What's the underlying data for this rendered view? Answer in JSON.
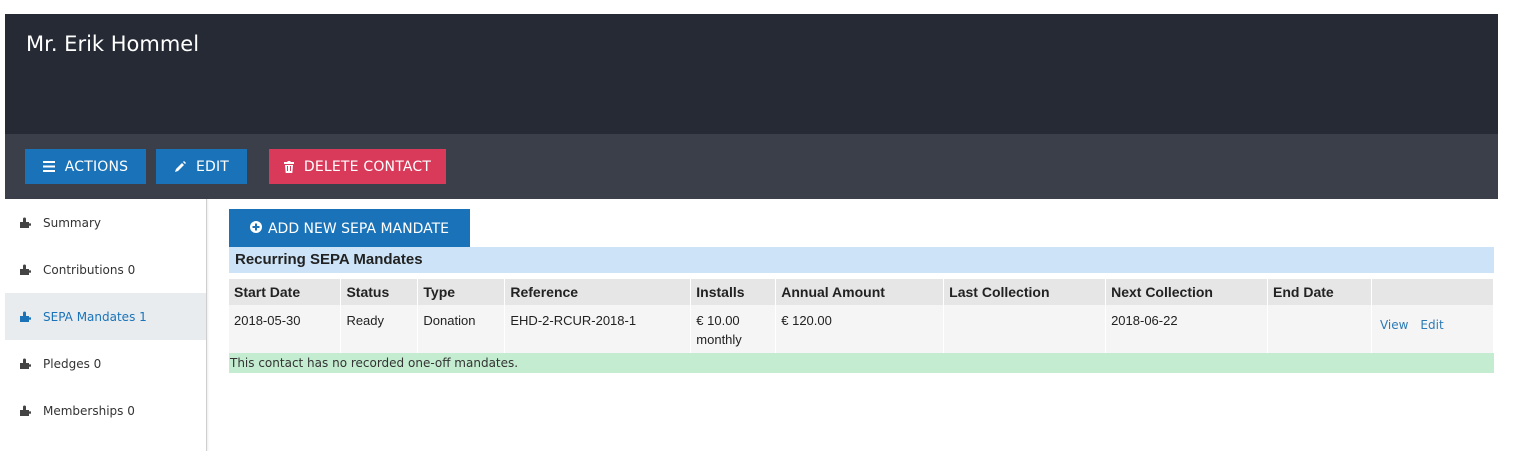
{
  "contact": {
    "name": "Mr. Erik Hommel"
  },
  "actions": {
    "actions_label": "ACTIONS",
    "actions_icon": "hamburger-icon",
    "edit_label": "EDIT",
    "edit_icon": "pencil-icon",
    "delete_label": "DELETE CONTACT",
    "delete_icon": "trash-icon"
  },
  "colors": {
    "header_bg": "#262a35",
    "actionbar_bg": "#3b3f4a",
    "primary": "#1a73b8",
    "danger": "#d93a5a",
    "section_bg": "#cde4f8",
    "notice_bg": "#c3ecd0"
  },
  "sidebar": {
    "items": [
      {
        "label": "Summary",
        "icon": "puzzle-icon",
        "active": false
      },
      {
        "label": "Contributions 0",
        "icon": "puzzle-icon",
        "active": false
      },
      {
        "label": "SEPA Mandates 1",
        "icon": "puzzle-icon",
        "active": true
      },
      {
        "label": "Pledges 0",
        "icon": "puzzle-icon",
        "active": false
      },
      {
        "label": "Memberships 0",
        "icon": "puzzle-icon",
        "active": false
      }
    ]
  },
  "main": {
    "add_button": "ADD NEW SEPA MANDATE",
    "add_icon": "plus-circle-icon",
    "section_title": "Recurring SEPA Mandates",
    "columns": [
      "Start Date",
      "Status",
      "Type",
      "Reference",
      "Installs",
      "Annual Amount",
      "Last Collection",
      "Next Collection",
      "End Date",
      ""
    ],
    "rows": [
      {
        "start_date": "2018-05-30",
        "status": "Ready",
        "type": "Donation",
        "reference": "EHD-2-RCUR-2018-1",
        "installs_amount": "€ 10.00",
        "installs_frequency": "monthly",
        "annual_amount": "€ 120.00",
        "last_collection": "",
        "next_collection": "2018-06-22",
        "end_date": "",
        "view_link": "View",
        "edit_link": "Edit"
      }
    ],
    "notice": "This contact has no recorded one-off mandates."
  }
}
